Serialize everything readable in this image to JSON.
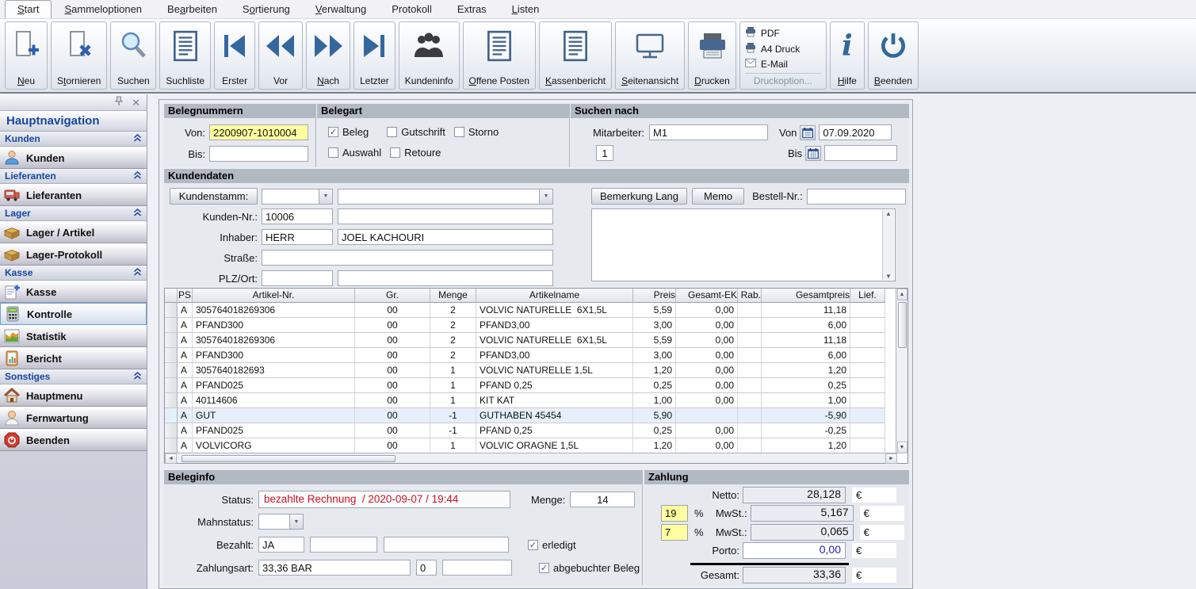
{
  "menubar": {
    "tabs": [
      {
        "label": "Start",
        "ul": 0
      },
      {
        "label": "Sammeloptionen",
        "ul": 0
      },
      {
        "label": "Bearbeiten",
        "ul": 2
      },
      {
        "label": "Sortierung",
        "ul": 1
      },
      {
        "label": "Verwaltung",
        "ul": 0
      },
      {
        "label": "Protokoll",
        "ul": -1
      },
      {
        "label": "Extras",
        "ul": -1
      },
      {
        "label": "Listen",
        "ul": 0
      }
    ]
  },
  "toolbar": {
    "buttons": [
      {
        "label": "Neu",
        "ul": 0
      },
      {
        "label": "Stornieren",
        "ul": 1
      },
      {
        "label": "Suchen",
        "ul": -1
      },
      {
        "label": "Suchliste",
        "ul": -1
      },
      {
        "label": "Erster",
        "ul": -1
      },
      {
        "label": "Vor",
        "ul": -1
      },
      {
        "label": "Nach",
        "ul": 0
      },
      {
        "label": "Letzter",
        "ul": -1
      },
      {
        "label": "Kundeninfo",
        "ul": -1
      },
      {
        "label": "Offene Posten",
        "ul": 0
      },
      {
        "label": "Kassenbericht",
        "ul": 0
      },
      {
        "label": "Seitenansicht",
        "ul": 0
      },
      {
        "label": "Drucken",
        "ul": 0
      }
    ],
    "print_menu": {
      "items": [
        "PDF",
        "A4 Druck",
        "E-Mail"
      ],
      "footer": "Druckoption..."
    },
    "hilfe": {
      "label": "Hilfe",
      "ul": 0
    },
    "beenden": {
      "label": "Beenden",
      "ul": 0
    }
  },
  "sidebar": {
    "title": "Hauptnavigation",
    "sections": [
      {
        "header": "Kunden",
        "items": [
          {
            "label": "Kunden"
          }
        ]
      },
      {
        "header": "Lieferanten",
        "items": [
          {
            "label": "Lieferanten"
          }
        ]
      },
      {
        "header": "Lager",
        "items": [
          {
            "label": "Lager / Artikel"
          },
          {
            "label": "Lager-Protokoll"
          }
        ]
      },
      {
        "header": "Kasse",
        "items": [
          {
            "label": "Kasse"
          },
          {
            "label": "Kontrolle",
            "selected": true
          },
          {
            "label": "Statistik"
          },
          {
            "label": "Bericht"
          }
        ]
      },
      {
        "header": "Sonstiges",
        "items": [
          {
            "label": "Hauptmenu"
          },
          {
            "label": "Fernwartung"
          },
          {
            "label": "Beenden"
          }
        ]
      }
    ]
  },
  "filters": {
    "belegnummern": {
      "title": "Belegnummern",
      "von_label": "Von:",
      "von_value": "2200907-1010004",
      "bis_label": "Bis:",
      "bis_value": ""
    },
    "belegart": {
      "title": "Belegart",
      "options": [
        {
          "label": "Beleg",
          "checked": true
        },
        {
          "label": "Gutschrift",
          "checked": false
        },
        {
          "label": "Storno",
          "checked": false
        },
        {
          "label": "Auswahl",
          "checked": false
        },
        {
          "label": "Retoure",
          "checked": false
        }
      ]
    },
    "suchen": {
      "title": "Suchen nach",
      "mitarbeiter_label": "Mitarbeiter:",
      "mitarbeiter_value": "M1",
      "count_value": "1",
      "von_label": "Von",
      "von_value": "07.09.2020",
      "bis_label": "Bis",
      "bis_value": ""
    }
  },
  "kundendaten": {
    "title": "Kundendaten",
    "kundenstamm_label": "Kundenstamm:",
    "kundennr_label": "Kunden-Nr.:",
    "kundennr_value": "10006",
    "kundennr_extra": "",
    "inhaber_label": "Inhaber:",
    "anrede_value": "HERR",
    "name_value": "JOEL KACHOURI",
    "strasse_label": "Straße:",
    "strasse_value": "",
    "plzort_label": "PLZ/Ort:",
    "plz_value": "",
    "ort_value": "",
    "bemerkung_button": "Bemerkung Lang",
    "memo_button": "Memo",
    "bestellnr_label": "Bestell-Nr.:",
    "bestellnr_value": "",
    "memo_text": ""
  },
  "table": {
    "columns": [
      "PS",
      "Artikel-Nr.",
      "Gr.",
      "Menge",
      "Artikelname",
      "Preis",
      "Gesamt-EK",
      "Rab.",
      "Gesamtpreis",
      "Lief."
    ],
    "rows": [
      {
        "ps": "A",
        "artnr": "305764018269306",
        "gr": "00",
        "menge": "2",
        "name": "VOLVIC NATURELLE  6X1,5L",
        "preis": "5,59",
        "ek": "0,00",
        "rab": "",
        "gesamt": "11,18",
        "lief": ""
      },
      {
        "ps": "A",
        "artnr": "PFAND300",
        "gr": "00",
        "menge": "2",
        "name": "PFAND3,00",
        "preis": "3,00",
        "ek": "0,00",
        "rab": "",
        "gesamt": "6,00",
        "lief": ""
      },
      {
        "ps": "A",
        "artnr": "305764018269306",
        "gr": "00",
        "menge": "2",
        "name": "VOLVIC NATURELLE  6X1,5L",
        "preis": "5,59",
        "ek": "0,00",
        "rab": "",
        "gesamt": "11,18",
        "lief": ""
      },
      {
        "ps": "A",
        "artnr": "PFAND300",
        "gr": "00",
        "menge": "2",
        "name": "PFAND3,00",
        "preis": "3,00",
        "ek": "0,00",
        "rab": "",
        "gesamt": "6,00",
        "lief": ""
      },
      {
        "ps": "A",
        "artnr": "3057640182693",
        "gr": "00",
        "menge": "1",
        "name": "VOLVIC NATURELLE 1,5L",
        "preis": "1,20",
        "ek": "0,00",
        "rab": "",
        "gesamt": "1,20",
        "lief": ""
      },
      {
        "ps": "A",
        "artnr": "PFAND025",
        "gr": "00",
        "menge": "1",
        "name": "PFAND 0,25",
        "preis": "0,25",
        "ek": "0,00",
        "rab": "",
        "gesamt": "0,25",
        "lief": ""
      },
      {
        "ps": "A",
        "artnr": "40114606",
        "gr": "00",
        "menge": "1",
        "name": "KIT KAT",
        "preis": "1,00",
        "ek": "0,00",
        "rab": "",
        "gesamt": "1,00",
        "lief": ""
      },
      {
        "ps": "A",
        "artnr": "GUT",
        "gr": "00",
        "menge": "-1",
        "name": "GUTHABEN 45454",
        "preis": "5,90",
        "ek": "",
        "rab": "",
        "gesamt": "-5,90",
        "lief": "",
        "cls": "hl"
      },
      {
        "ps": "A",
        "artnr": "PFAND025",
        "gr": "00",
        "menge": "-1",
        "name": "PFAND 0,25",
        "preis": "0,25",
        "ek": "0,00",
        "rab": "",
        "gesamt": "-0,25",
        "lief": ""
      },
      {
        "ps": "A",
        "artnr": "VOLVICORG",
        "gr": "00",
        "menge": "1",
        "name": "VOLVIC ORAGNE 1,5L",
        "preis": "1,20",
        "ek": "0,00",
        "rab": "",
        "gesamt": "1,20",
        "lief": ""
      }
    ]
  },
  "beleginfo": {
    "title": "Beleginfo",
    "status_label": "Status:",
    "status_value": "bezahlte Rechnung  / 2020-09-07 / 19:44",
    "menge_label": "Menge:",
    "menge_value": "14",
    "mahnstatus_label": "Mahnstatus:",
    "mahnstatus_value": "",
    "bezahlt_label": "Bezahlt:",
    "bezahlt_value": "JA",
    "bezahlt_extra1": "",
    "bezahlt_extra2": "",
    "zahlungsart_label": "Zahlungsart:",
    "zahlungsart_value": "33,36 BAR",
    "zahlungsart_code": "0",
    "zahlungsart_extra": "",
    "erledigt_label": "erledigt",
    "erledigt_checked": true,
    "abgebucht_label": "abgebuchter Beleg",
    "abgebucht_checked": true
  },
  "zahlung": {
    "title": "Zahlung",
    "currency": "€",
    "pct": "%",
    "netto_label": "Netto:",
    "netto_value": "28,128",
    "mwst1_rate": "19",
    "mwst1_label": "MwSt.:",
    "mwst1_value": "5,167",
    "mwst2_rate": "7",
    "mwst2_label": "MwSt.:",
    "mwst2_value": "0,065",
    "porto_label": "Porto:",
    "porto_value": "0,00",
    "gesamt_label": "Gesamt:",
    "gesamt_value": "33,36"
  }
}
